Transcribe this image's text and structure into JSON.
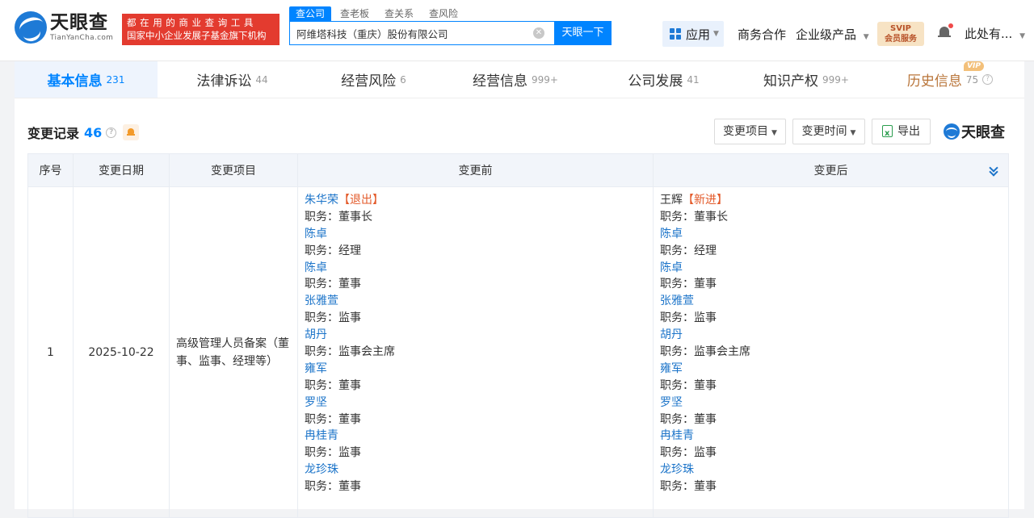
{
  "header": {
    "logo_cn": "天眼查",
    "logo_en": "TianYanCha.com",
    "slogan_line1": "都在用的商业查询工具",
    "slogan_line2": "国家中小企业发展子基金旗下机构",
    "search_tabs": [
      "查公司",
      "查老板",
      "查关系",
      "查风险"
    ],
    "search_value": "阿维塔科技（重庆）股份有限公司",
    "search_button": "天眼一下",
    "app_label": "应用",
    "nav_business": "商务合作",
    "nav_enterprise": "企业级产品",
    "svip_line1": "SVIP",
    "svip_line2": "会员服务",
    "user_label": "此处有..."
  },
  "tabs": [
    {
      "label": "基本信息",
      "count": "231"
    },
    {
      "label": "法律诉讼",
      "count": "44"
    },
    {
      "label": "经营风险",
      "count": "6"
    },
    {
      "label": "经营信息",
      "count": "999+"
    },
    {
      "label": "公司发展",
      "count": "41"
    },
    {
      "label": "知识产权",
      "count": "999+"
    },
    {
      "label": "历史信息",
      "count": "75",
      "badge": "VIP"
    }
  ],
  "section": {
    "title": "变更记录",
    "count": "46",
    "filter_item": "变更项目",
    "filter_time": "变更时间",
    "export": "导出",
    "brand": "天眼查"
  },
  "table": {
    "headers": [
      "序号",
      "变更日期",
      "变更项目",
      "变更前",
      "变更后"
    ],
    "rows": [
      {
        "index": "1",
        "date": "2025-10-22",
        "item": "高级管理人员备案（董事、监事、经理等）",
        "before": [
          {
            "name": "朱华荣",
            "tag": "【退出】",
            "role": "职务：董事长"
          },
          {
            "name": "陈卓",
            "tag": "",
            "role": "职务：经理"
          },
          {
            "name": "陈卓",
            "tag": "",
            "role": "职务：董事"
          },
          {
            "name": "张雅萱",
            "tag": "",
            "role": "职务：监事"
          },
          {
            "name": "胡丹",
            "tag": "",
            "role": "职务：监事会主席"
          },
          {
            "name": "雍军",
            "tag": "",
            "role": "职务：董事"
          },
          {
            "name": "罗坚",
            "tag": "",
            "role": "职务：董事"
          },
          {
            "name": "冉桂青",
            "tag": "",
            "role": "职务：监事"
          },
          {
            "name": "龙珍珠",
            "tag": "",
            "role": "职务：董事"
          }
        ],
        "after": [
          {
            "name": "王辉",
            "tag": "【新进】",
            "role": "职务：董事长"
          },
          {
            "name": "陈卓",
            "tag": "",
            "role": "职务：经理"
          },
          {
            "name": "陈卓",
            "tag": "",
            "role": "职务：董事"
          },
          {
            "name": "张雅萱",
            "tag": "",
            "role": "职务：监事"
          },
          {
            "name": "胡丹",
            "tag": "",
            "role": "职务：监事会主席"
          },
          {
            "name": "雍军",
            "tag": "",
            "role": "职务：董事"
          },
          {
            "name": "罗坚",
            "tag": "",
            "role": "职务：董事"
          },
          {
            "name": "冉桂青",
            "tag": "",
            "role": "职务：监事"
          },
          {
            "name": "龙珍珠",
            "tag": "",
            "role": "职务：董事"
          }
        ]
      }
    ]
  },
  "colors": {
    "accent": "#0084ff",
    "link": "#1c74c9",
    "tag": "#e35a2a",
    "slogan_bg": "#e33b2f",
    "history_tab": "#b9753a"
  }
}
